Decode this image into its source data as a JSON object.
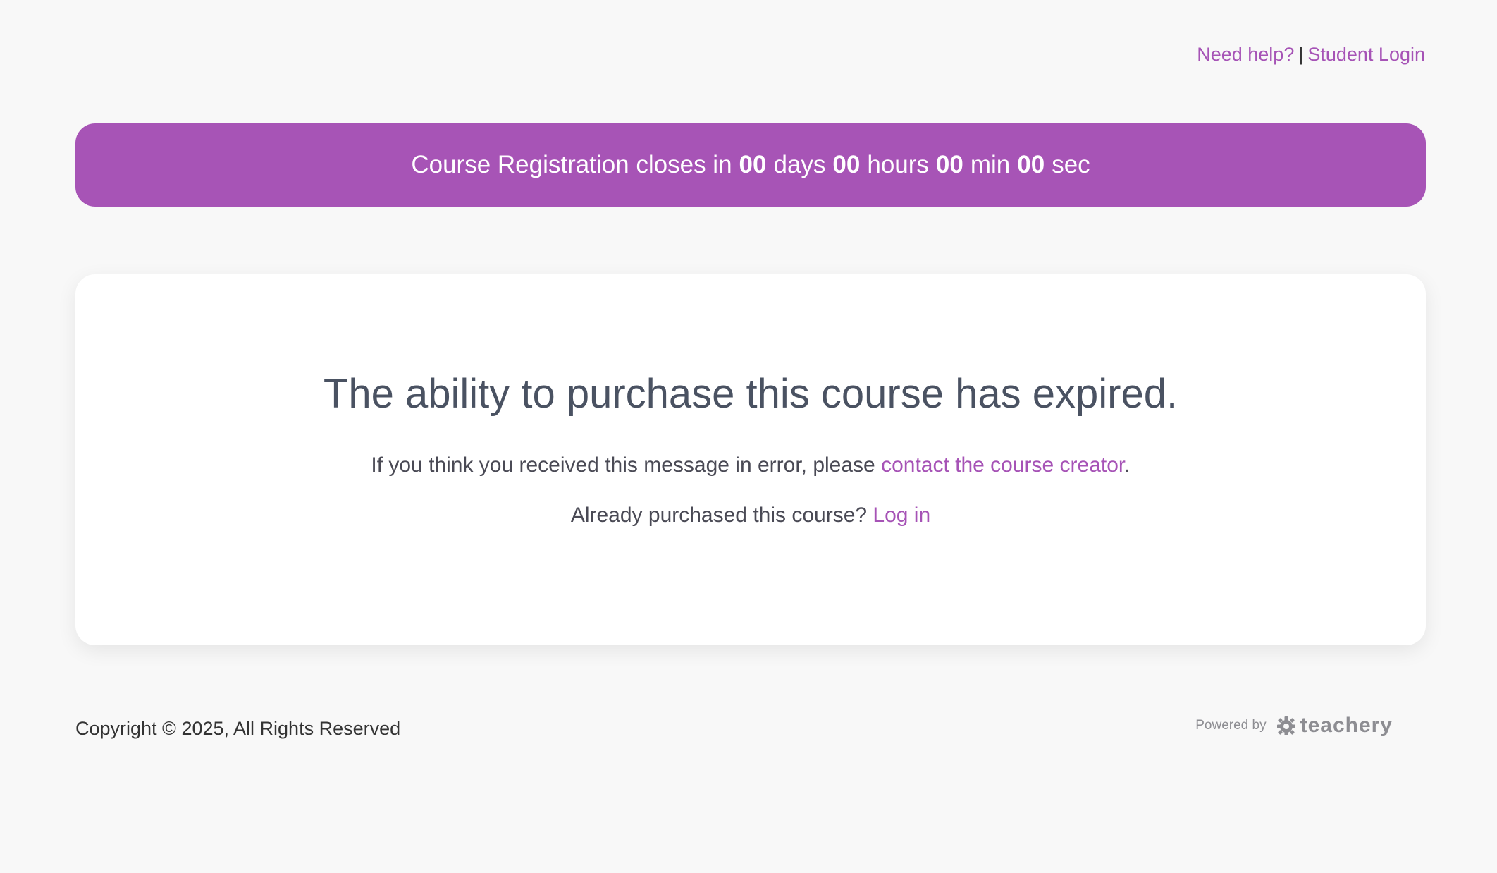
{
  "header": {
    "help_link": "Need help?",
    "separator": "|",
    "student_login_link": "Student Login"
  },
  "countdown": {
    "prefix": "Course Registration closes in",
    "days_value": "00",
    "days_unit": "days",
    "hours_value": "00",
    "hours_unit": "hours",
    "min_value": "00",
    "min_unit": "min",
    "sec_value": "00",
    "sec_unit": "sec",
    "background_color": "#a754b6"
  },
  "card": {
    "heading": "The ability to purchase this course has expired.",
    "error_text_prefix": "If you think you received this message in error, please",
    "contact_link": "contact the course creator",
    "error_text_suffix": ".",
    "already_text": "Already purchased this course?",
    "login_link": "Log in"
  },
  "footer": {
    "copyright": "Copyright © 2025, All Rights Reserved",
    "powered_by": "Powered by",
    "brand": "teachery",
    "brand_icon": "gear-icon"
  },
  "colors": {
    "accent": "#a653b6",
    "background": "#f8f8f8",
    "heading": "#4a5262"
  }
}
